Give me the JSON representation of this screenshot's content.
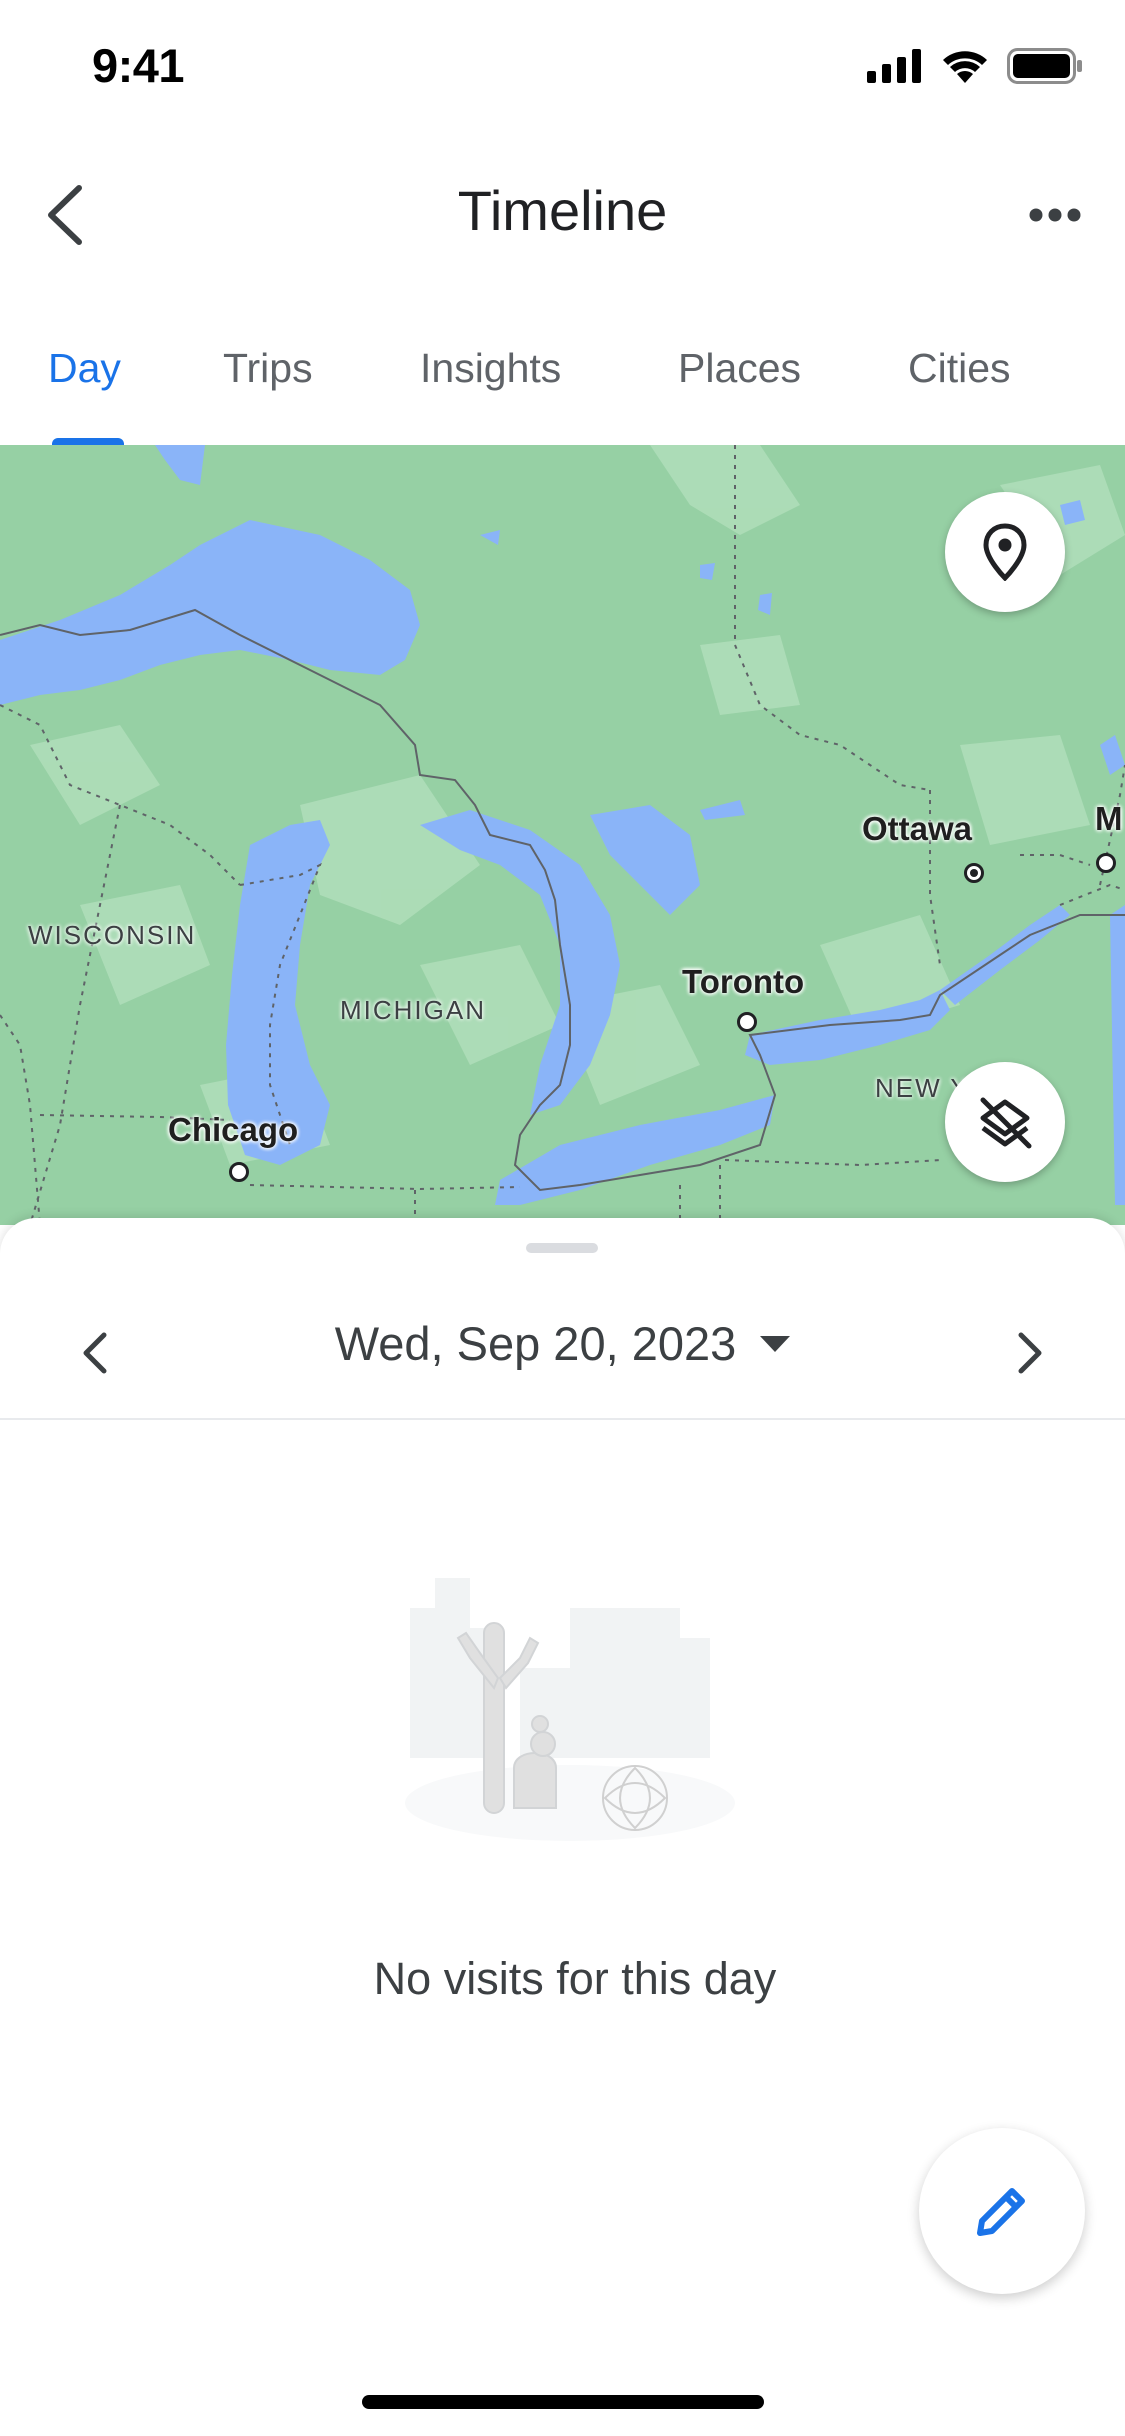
{
  "status_bar": {
    "time": "9:41",
    "icons": [
      "cellular-signal-icon",
      "wifi-icon",
      "battery-icon"
    ]
  },
  "header": {
    "title": "Timeline",
    "back_icon": "chevron-left-icon",
    "more_icon": "more-horizontal-icon"
  },
  "tabs": [
    {
      "label": "Day",
      "active": true
    },
    {
      "label": "Trips",
      "active": false
    },
    {
      "label": "Insights",
      "active": false
    },
    {
      "label": "Places",
      "active": false
    },
    {
      "label": "Cities",
      "active": false
    }
  ],
  "map": {
    "cities": [
      {
        "name": "Ottawa"
      },
      {
        "name": "Toronto"
      },
      {
        "name": "Chicago"
      },
      {
        "name": "M"
      }
    ],
    "regions": [
      "WISCONSIN",
      "MICHIGAN",
      "NEW Y"
    ],
    "buttons": {
      "location_icon": "location-pin-icon",
      "layers_icon": "layers-off-icon"
    },
    "colors": {
      "land": "#96d0a4",
      "water": "#8ab4f8"
    }
  },
  "sheet": {
    "date": "Wed, Sep 20, 2023",
    "empty_message": "No visits for this day",
    "edit_icon": "pencil-icon"
  },
  "colors": {
    "accent": "#1a73e8",
    "text_primary": "#202124",
    "text_secondary": "#5f6368"
  }
}
